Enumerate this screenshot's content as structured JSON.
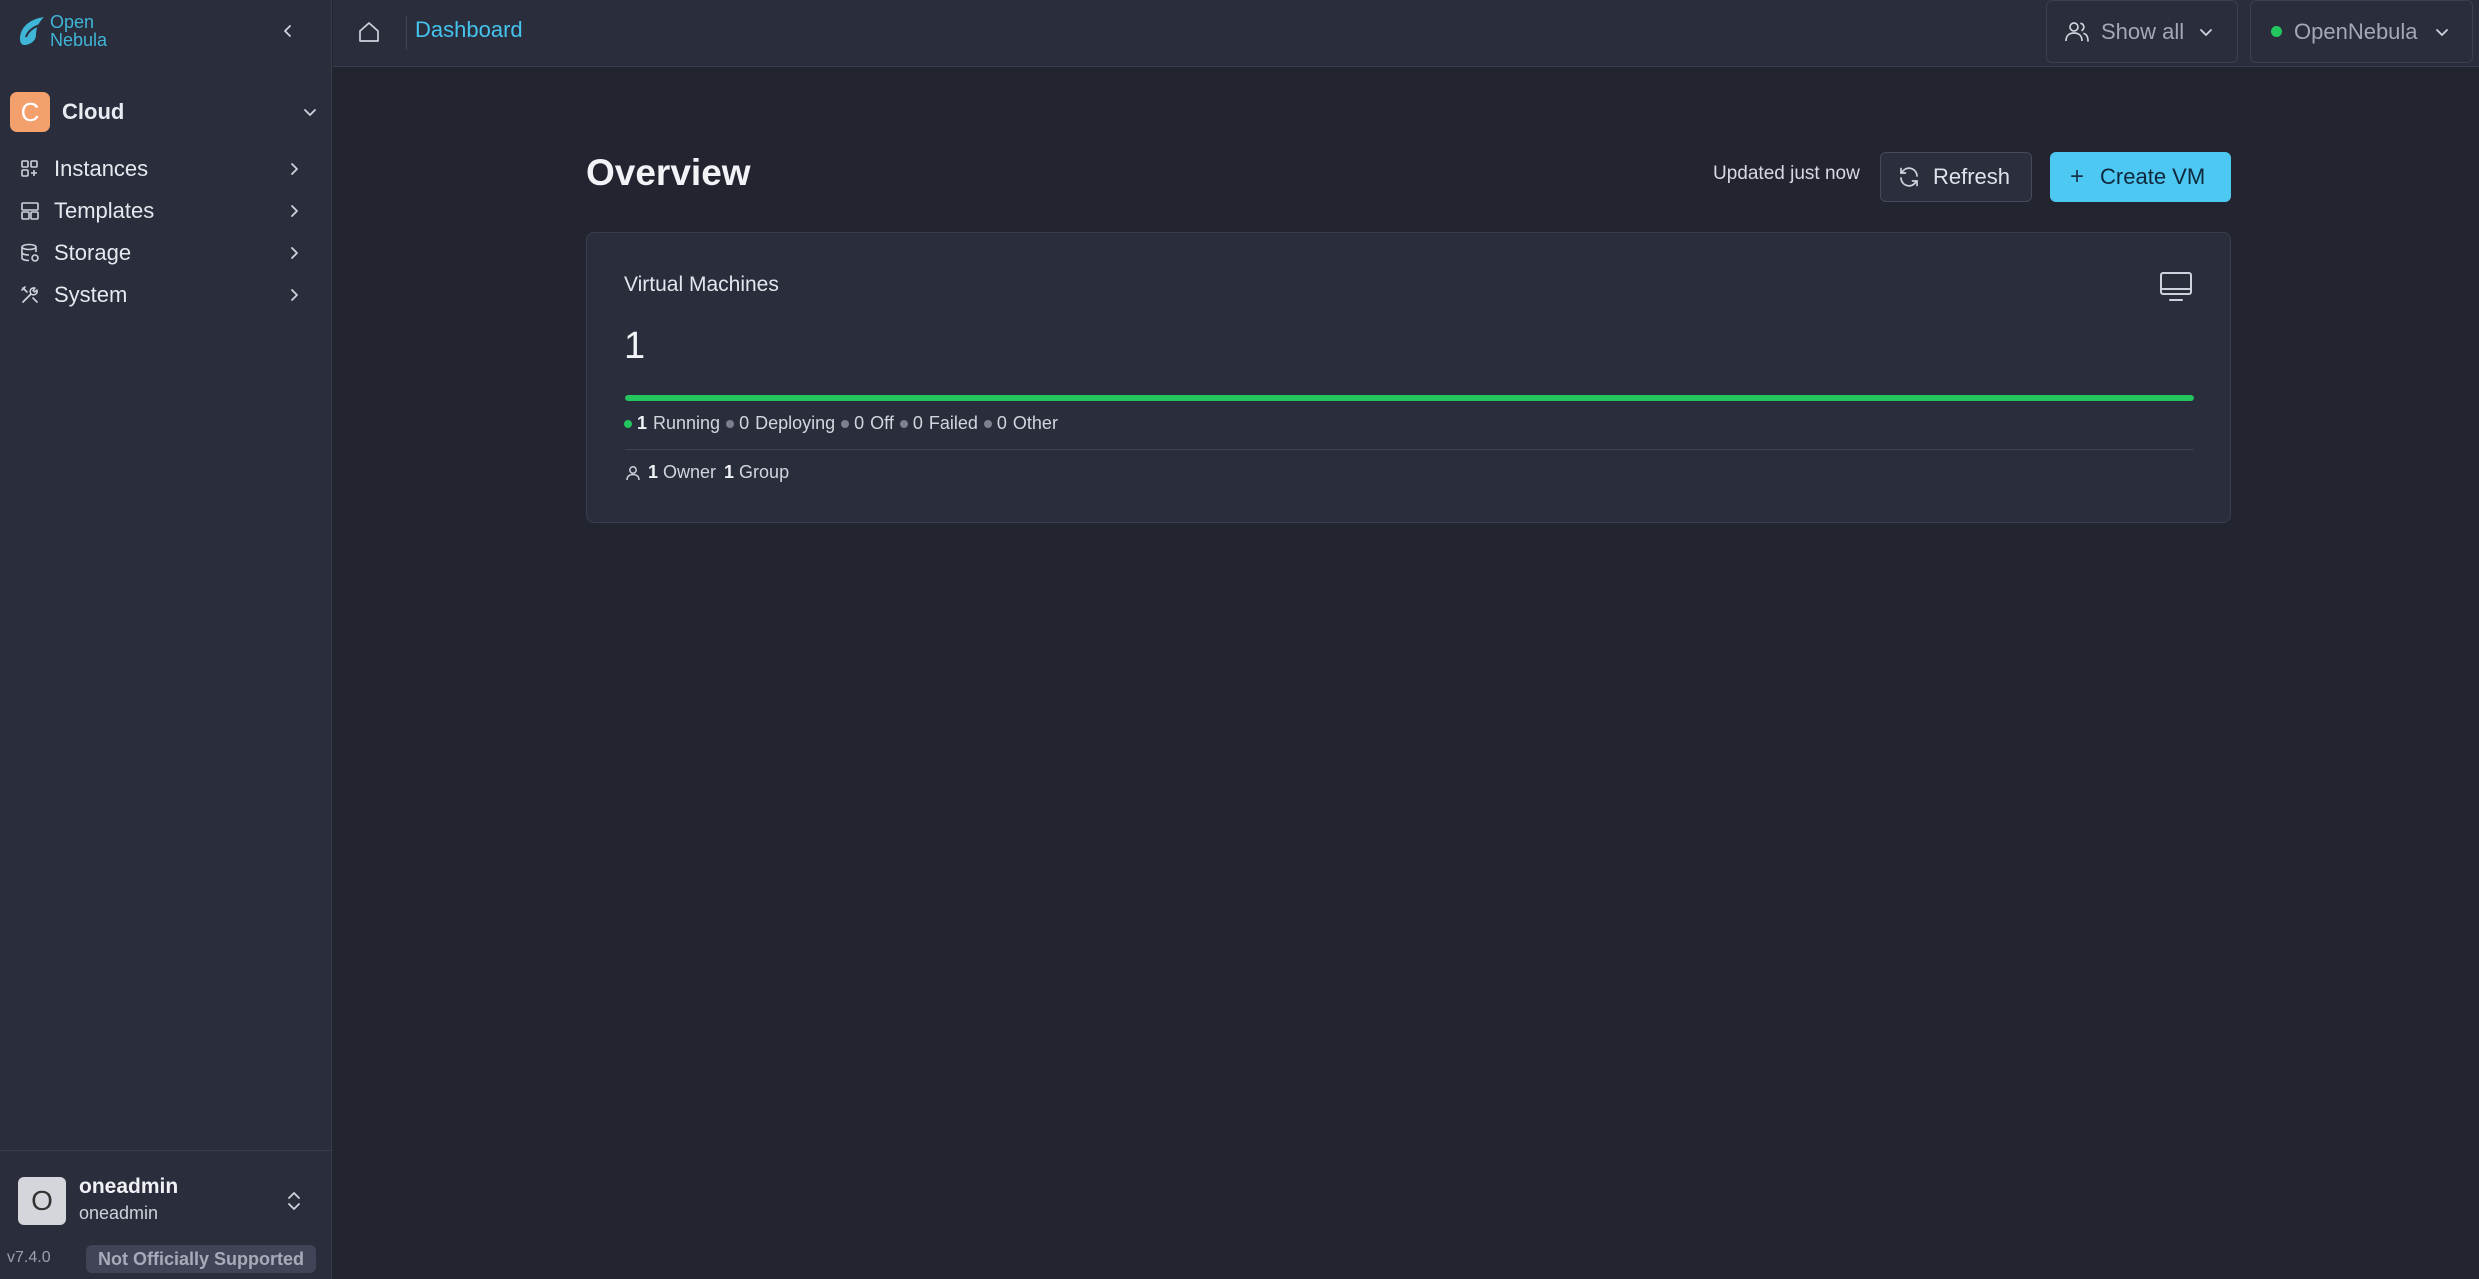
{
  "app": {
    "logo_line1": "Open",
    "logo_line2": "Nebula",
    "version": "v7.4.0",
    "support_badge": "Not Officially Supported"
  },
  "sidebar": {
    "group": {
      "initial": "C",
      "label": "Cloud"
    },
    "items": [
      {
        "label": "Instances",
        "icon": "instances-icon"
      },
      {
        "label": "Templates",
        "icon": "templates-icon"
      },
      {
        "label": "Storage",
        "icon": "storage-icon"
      },
      {
        "label": "System",
        "icon": "system-icon"
      }
    ],
    "user": {
      "initial": "O",
      "name": "oneadmin",
      "group": "oneadmin"
    }
  },
  "topbar": {
    "breadcrumb": "Dashboard",
    "filter_label": "Show all",
    "zone_label": "OpenNebula",
    "zone_status_color": "#22c55e"
  },
  "main": {
    "title": "Overview",
    "updated_text": "Updated just now",
    "refresh_label": "Refresh",
    "create_label": "Create VM",
    "create_plus": "+",
    "card": {
      "title": "Virtual Machines",
      "total": "1",
      "running_fraction": 1.0,
      "statuses": [
        {
          "count": "1",
          "label": "Running",
          "color": "#22c55e"
        },
        {
          "count": "0",
          "label": "Deploying",
          "color": "#7c8090"
        },
        {
          "count": "0",
          "label": "Off",
          "color": "#7c8090"
        },
        {
          "count": "0",
          "label": "Failed",
          "color": "#7c8090"
        },
        {
          "count": "0",
          "label": "Other",
          "color": "#7c8090"
        }
      ],
      "owner_count": "1",
      "owner_label": "Owner",
      "group_count": "1",
      "group_label": "Group"
    }
  },
  "colors": {
    "accent": "#4cc8f2",
    "link": "#45c3ef",
    "running": "#22c55e",
    "background": "#22242f",
    "panel": "#2a2d3b"
  }
}
